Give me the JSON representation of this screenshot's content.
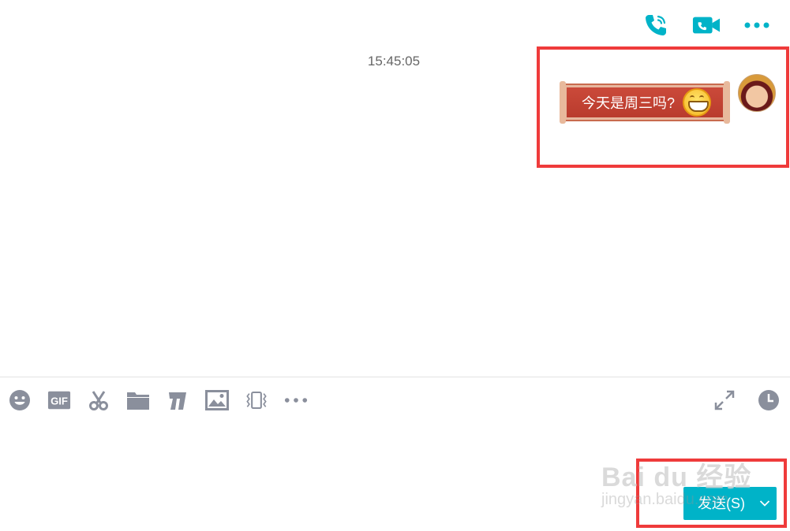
{
  "header": {
    "actions": [
      {
        "icon": "phone-call-icon"
      },
      {
        "icon": "video-call-icon"
      },
      {
        "icon": "more-options-icon"
      }
    ],
    "accent_color": "#00b3c8"
  },
  "conversation": {
    "timestamp": "15:45:05",
    "messages": [
      {
        "sender": "self",
        "text": "今天是周三吗?",
        "emoji": "grinning-face-icon",
        "avatar": "opera-mask-avatar"
      }
    ]
  },
  "toolbar": {
    "tools": [
      {
        "icon": "emoji-icon"
      },
      {
        "icon": "gif-icon",
        "label": "GIF"
      },
      {
        "icon": "screenshot-scissors-icon"
      },
      {
        "icon": "file-folder-icon"
      },
      {
        "icon": "font-style-icon"
      },
      {
        "icon": "image-icon"
      },
      {
        "icon": "shake-window-icon"
      },
      {
        "icon": "more-tools-icon"
      }
    ],
    "right_tools": [
      {
        "icon": "expand-icon"
      },
      {
        "icon": "history-clock-icon"
      }
    ]
  },
  "composer": {
    "value": "",
    "send_label": "发送(S)",
    "send_dropdown_icon": "chevron-down-icon"
  },
  "watermark": {
    "main": "Bai du 经验",
    "sub": "jingyan.baidu.com"
  },
  "colors": {
    "highlight": "#ef3b3b",
    "icon_gray": "#8a8f9c",
    "bubble_red": "#c0412f"
  }
}
